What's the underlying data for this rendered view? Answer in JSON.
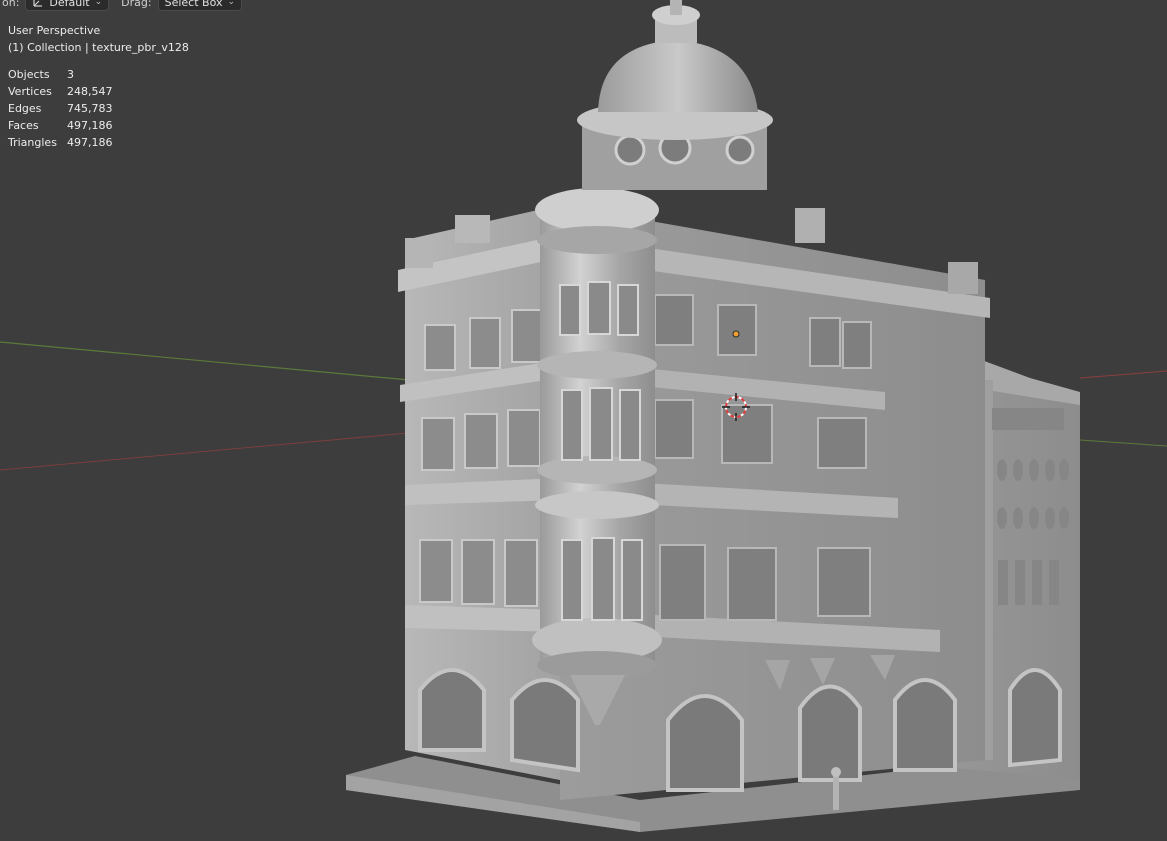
{
  "header": {
    "orientation_label": "on:",
    "orientation_value": "Default",
    "drag_label": "Drag:",
    "drag_value": "Select Box"
  },
  "overlay": {
    "view_name": "User Perspective",
    "collection_line": "(1) Collection | texture_pbr_v128"
  },
  "stats": [
    {
      "label": "Objects",
      "value": "3"
    },
    {
      "label": "Vertices",
      "value": "248,547"
    },
    {
      "label": "Edges",
      "value": "745,783"
    },
    {
      "label": "Faces",
      "value": "497,186"
    },
    {
      "label": "Triangles",
      "value": "497,186"
    }
  ],
  "colors": {
    "viewport_bg": "#3d3d3d",
    "x_axis": "#8a3f3f",
    "y_axis": "#5b7a3a",
    "mesh": "#a9a9a9",
    "origin_point": "#f0a030",
    "cursor": "#e04040"
  },
  "icons": {
    "orientation": "orientation-gizmo-icon",
    "chevron": "chevron-down-icon",
    "cursor": "3d-cursor-icon",
    "origin": "object-origin-icon"
  }
}
